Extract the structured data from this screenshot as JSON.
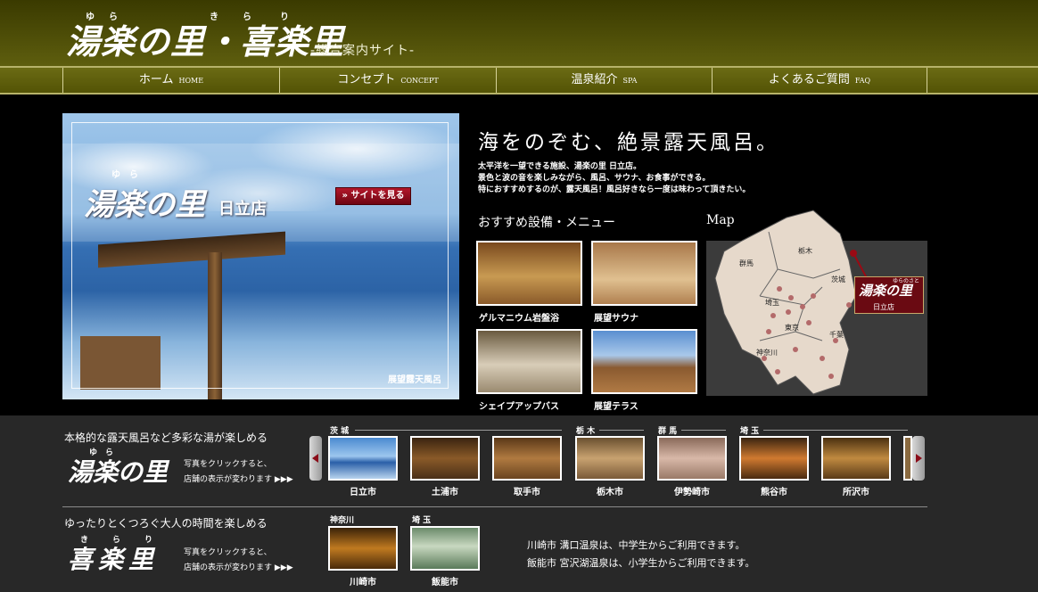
{
  "header": {
    "logo_text": "湯楽の里・喜楽里",
    "logo_ruby": [
      "ゆ",
      "ら",
      "き",
      "ら",
      "り"
    ],
    "subtitle": "-総合案内サイト-"
  },
  "nav": [
    {
      "label": "ホーム",
      "en": "HOME"
    },
    {
      "label": "コンセプト",
      "en": "CONCEPT"
    },
    {
      "label": "温泉紹介",
      "en": "SPA"
    },
    {
      "label": "よくあるご質問",
      "en": "FAQ"
    }
  ],
  "hero": {
    "logo_text": "湯楽の里",
    "logo_ruby": "ゆ　ら",
    "store_name": "日立店",
    "site_button": "» サイトを見る",
    "caption": "展望露天風呂"
  },
  "feature": {
    "headline": "海をのぞむ、絶景露天風呂。",
    "description": "太平洋を一望できる施設、湯楽の里 日立店。\n景色と波の音を楽しみながら、風呂、サウナ、お食事ができる。\n特におすすめするのが、露天風呂！風呂好きなら一度は味わって頂きたい。"
  },
  "recommend": {
    "heading": "おすすめ設備・メニュー",
    "items": [
      {
        "label": "ゲルマニウム岩盤浴"
      },
      {
        "label": "展望サウナ"
      },
      {
        "label": "シェイプアップバス"
      },
      {
        "label": "展望テラス"
      }
    ]
  },
  "map": {
    "heading": "Map",
    "labels": [
      "栃木",
      "群馬",
      "茨城",
      "埼玉",
      "東京",
      "千葉",
      "神奈川"
    ],
    "badge_logo": "湯楽の里",
    "badge_ruby": "ゆらのさと",
    "badge_store": "日立店"
  },
  "yurakunosato": {
    "title": "本格的な露天風呂など多彩な湯が楽しめる",
    "logo": "湯楽の里",
    "logo_ruby": "ゆ　ら",
    "click_text": "写真をクリックすると、\n店舗の表示が変わります ▶▶▶",
    "prefectures": [
      "茨 城",
      "栃 木",
      "群 馬",
      "埼 玉"
    ],
    "stores": [
      "日立市",
      "土浦市",
      "取手市",
      "栃木市",
      "伊勢崎市",
      "熊谷市",
      "所沢市"
    ]
  },
  "kirari": {
    "title": "ゆったりとくつろぐ大人の時間を楽しめる",
    "logo": "喜楽里",
    "logo_ruby": [
      "き",
      "ら",
      "り"
    ],
    "click_text": "写真をクリックすると、\n店舗の表示が変わります ▶▶▶",
    "prefectures": [
      "神奈川",
      "埼 玉"
    ],
    "stores": [
      "川崎市",
      "飯能市"
    ],
    "notes": [
      "川崎市 溝口温泉は、中学生からご利用できます。",
      "飯能市 宮沢湖温泉は、小学生からご利用できます。"
    ]
  },
  "colors": {
    "header_olive": "#5e5e0e",
    "nav_olive": "#6b6b14",
    "accent_red": "#8a0c18",
    "lower_bg": "#282828"
  }
}
